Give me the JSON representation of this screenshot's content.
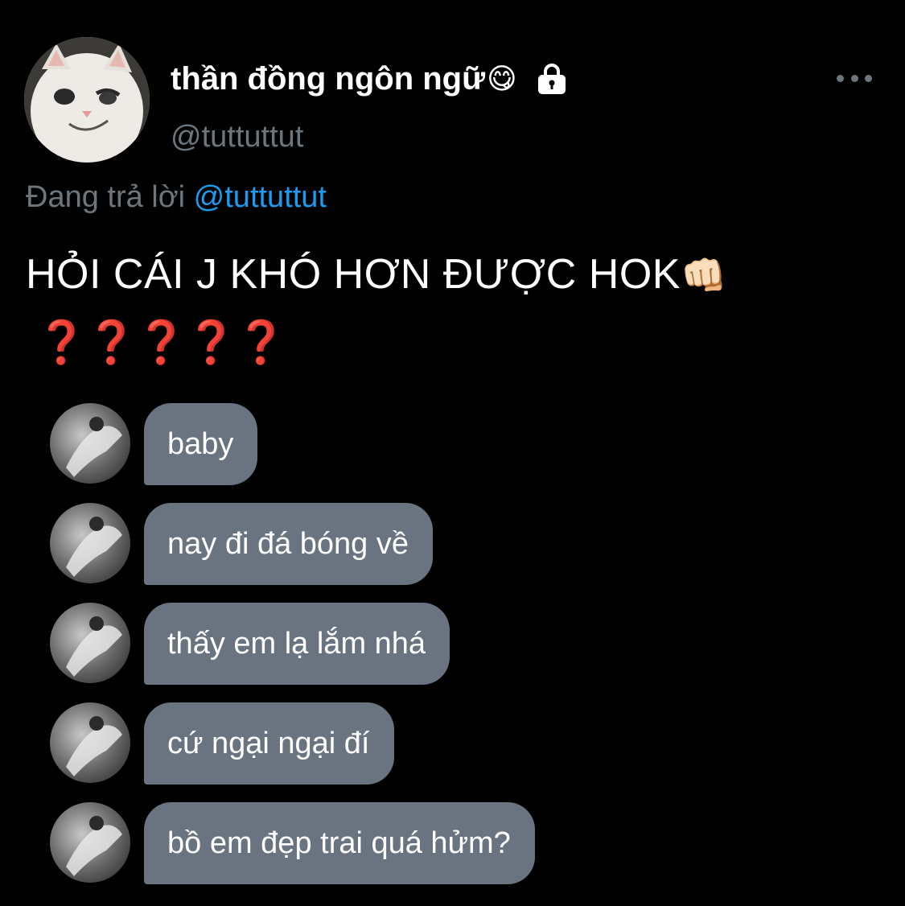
{
  "profile": {
    "display_name": "thần đồng ngôn ngữ",
    "name_emoji": "😋",
    "handle": "@tuttuttut",
    "avatar_icon": "cat-avatar-icon",
    "lock_icon": "lock-icon"
  },
  "reply": {
    "prefix": "Đang trả lời",
    "mention": "@tuttuttut"
  },
  "tweet": {
    "text": "HỎI CÁI J KHÓ HƠN ĐƯỢC HOK",
    "emoji": "👊🏻",
    "question_marks": [
      "❓",
      "❓",
      "❓",
      "❓",
      "❓"
    ]
  },
  "messages": [
    {
      "text": "baby"
    },
    {
      "text": "nay đi đá bóng về"
    },
    {
      "text": "thấy em lạ lắm nhá"
    },
    {
      "text": "cứ ngại ngại đí"
    },
    {
      "text": "bồ em đẹp trai quá hửm?"
    }
  ],
  "colors": {
    "background": "#000000",
    "secondary_text": "#6e767d",
    "mention": "#1d9bf0",
    "bubble": "#6a7380",
    "question_mark": "#d62a2a"
  }
}
